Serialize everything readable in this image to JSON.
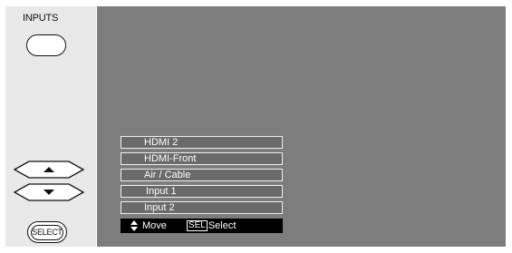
{
  "remote": {
    "inputs_label": "INPUTS",
    "select_label": "SELECT"
  },
  "menu": {
    "items": [
      {
        "label": "HDMI 2"
      },
      {
        "label": "HDMI-Front"
      },
      {
        "label": "Air / Cable"
      },
      {
        "label": "Input 1"
      },
      {
        "label": "Input 2"
      }
    ]
  },
  "help_bar": {
    "move_label": "Move",
    "sel_key": "SEL",
    "select_label": "Select"
  },
  "colors": {
    "screen_bg": "#7d7d7d",
    "menu_item_bg": "#6a6a6a",
    "help_bar_bg": "#000000",
    "panel_bg": "#e9e9e9"
  },
  "icons": {
    "up": "up-arrow-icon",
    "down": "down-arrow-icon",
    "updown": "up-down-arrows-icon"
  }
}
